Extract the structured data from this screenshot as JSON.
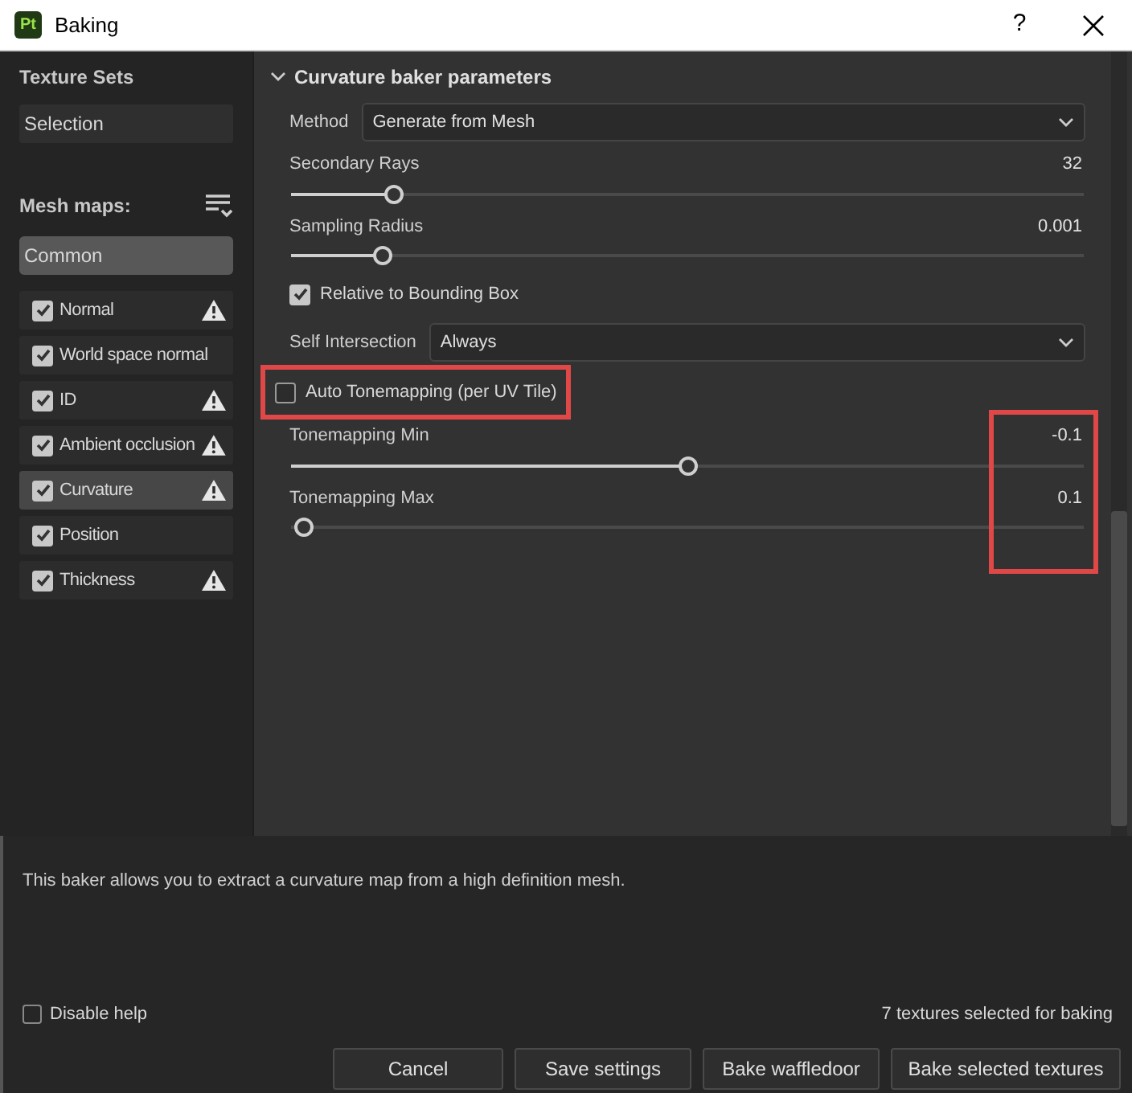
{
  "window": {
    "title": "Baking",
    "app_badge": "Pt",
    "help": "?"
  },
  "sidebar": {
    "texture_sets_title": "Texture Sets",
    "texture_sets": [
      {
        "label": "Selection",
        "selected": false
      }
    ],
    "mesh_maps_title": "Mesh maps:",
    "group": {
      "label": "Common",
      "selected": true
    },
    "maps": [
      {
        "label": "Normal",
        "checked": true,
        "warning": true,
        "selected": false
      },
      {
        "label": "World space normal",
        "checked": true,
        "warning": false,
        "selected": false
      },
      {
        "label": "ID",
        "checked": true,
        "warning": true,
        "selected": false
      },
      {
        "label": "Ambient occlusion",
        "checked": true,
        "warning": true,
        "selected": false
      },
      {
        "label": "Curvature",
        "checked": true,
        "warning": true,
        "selected": true
      },
      {
        "label": "Position",
        "checked": true,
        "warning": false,
        "selected": false
      },
      {
        "label": "Thickness",
        "checked": true,
        "warning": true,
        "selected": false
      }
    ]
  },
  "panel": {
    "title": "Curvature baker parameters",
    "expanded": true,
    "readings_highlighted": true,
    "params": [
      {
        "kind": "dropdown",
        "label": "Method",
        "value": "Generate from Mesh"
      },
      {
        "kind": "slider",
        "label": "Secondary Rays",
        "reading": "32",
        "level": 0.13
      },
      {
        "kind": "slider",
        "label": "Sampling Radius",
        "reading": "0.001",
        "level": 0.115
      },
      {
        "kind": "checkbox",
        "label": "Relative to Bounding Box",
        "checked": true,
        "highlighted": false
      },
      {
        "kind": "dropdown",
        "label": "Self Intersection",
        "value": "Always"
      },
      {
        "kind": "checkbox",
        "label": "Auto Tonemapping (per UV Tile)",
        "checked": false,
        "highlighted": true
      },
      {
        "kind": "slider",
        "label": "Tonemapping Min",
        "reading": "-0.1",
        "level": 0.5
      },
      {
        "kind": "slider",
        "label": "Tonemapping Max",
        "reading": "0.1",
        "level": 0
      }
    ]
  },
  "help_text": "This baker allows you to extract a curvature map from a high definition mesh.",
  "disable_help": {
    "label": "Disable help",
    "checked": false
  },
  "status": "7 textures selected for baking",
  "buttons": [
    "Cancel",
    "Save settings",
    "Bake waffledoor",
    "Bake selected textures"
  ]
}
